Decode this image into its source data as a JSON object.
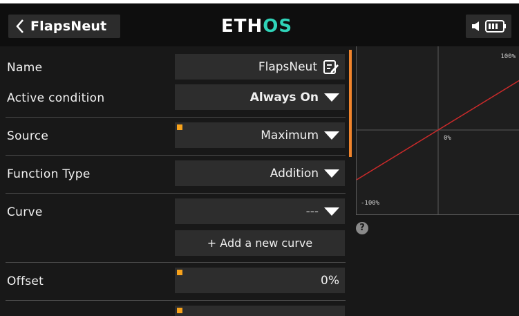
{
  "header": {
    "title": "FlapsNeut",
    "logo": {
      "part1": "ETH",
      "part2": "OS"
    }
  },
  "form": {
    "name": {
      "label": "Name",
      "value": "FlapsNeut"
    },
    "active_condition": {
      "label": "Active condition",
      "value": "Always On"
    },
    "source": {
      "label": "Source",
      "value": "Maximum"
    },
    "function_type": {
      "label": "Function Type",
      "value": "Addition"
    },
    "curve": {
      "label": "Curve",
      "value": "---",
      "add_label": "+ Add a new curve"
    },
    "offset": {
      "label": "Offset",
      "value": "0%"
    }
  },
  "graph": {
    "label_top": "100%",
    "label_mid": "0%",
    "label_bottom": "-100%",
    "line_color": "#cc2a2a"
  },
  "colors": {
    "accent_orange": "#f7a21b",
    "logo_teal": "#2fd3b8"
  },
  "help_glyph": "?"
}
